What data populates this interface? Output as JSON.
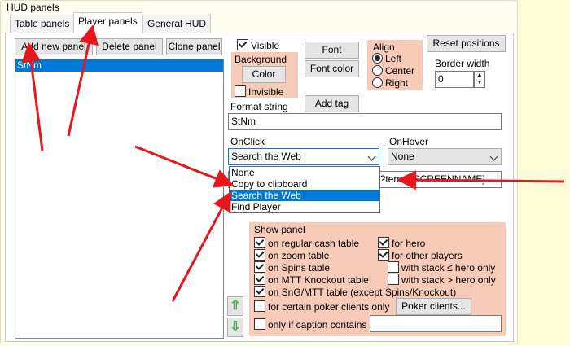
{
  "group_title": "HUD panels",
  "tabs": [
    {
      "label": "Table panels",
      "active": false
    },
    {
      "label": "Player panels",
      "active": true
    },
    {
      "label": "General HUD",
      "active": false
    }
  ],
  "left": {
    "add_label": "Add new panel",
    "delete_label": "Delete panel",
    "clone_label": "Clone panel",
    "list_items": [
      "StNm"
    ]
  },
  "right": {
    "visible_label": "Visible",
    "visible_checked": true,
    "background_label": "Background",
    "color_label": "Color",
    "invisible_label": "Invisible",
    "invisible_checked": false,
    "font_label": "Font",
    "font_color_label": "Font color",
    "add_tag_label": "Add tag",
    "align_label": "Align",
    "align_options": [
      "Left",
      "Center",
      "Right"
    ],
    "align_selected": "Left",
    "reset_label": "Reset positions",
    "border_width_label": "Border width",
    "border_width_value": "0",
    "format_string_label": "Format string",
    "format_string_value": "StNm",
    "onclick_label": "OnClick",
    "onclick_value": "Search the Web",
    "onhover_label": "OnHover",
    "onhover_value": "None",
    "url_value": "ch?term=[SCREENNAME]",
    "dropdown_options": [
      "None",
      "Copy to clipboard",
      "Search the Web",
      "Find Player"
    ],
    "dropdown_highlight": "Search the Web"
  },
  "show_panel": {
    "title": "Show panel",
    "regular_cash": "on regular cash table",
    "zoom": "on zoom table",
    "spins": "on Spins table",
    "mtt_knockout": "on MTT Knockout table",
    "sng_mtt": "on SnG/MTT table (except Spins/Knockout)",
    "certain_clients": "for certain poker clients only",
    "poker_clients_btn": "Poker clients...",
    "caption_contains": "only if caption contains",
    "caption_value": "",
    "for_hero": "for hero",
    "for_other": "for other players",
    "stack_le": "with stack ≤ hero only",
    "stack_gt": "with stack > hero only"
  },
  "colors": {
    "accent": "#0078d7",
    "pink_panel": "#f8cbb8",
    "annotation_arrow": "#e8161b",
    "outer_background": "#fefcd9"
  },
  "icons": [
    "up-arrow-icon",
    "down-arrow-icon",
    "chevron-down-icon",
    "annotation-arrow-icon"
  ]
}
